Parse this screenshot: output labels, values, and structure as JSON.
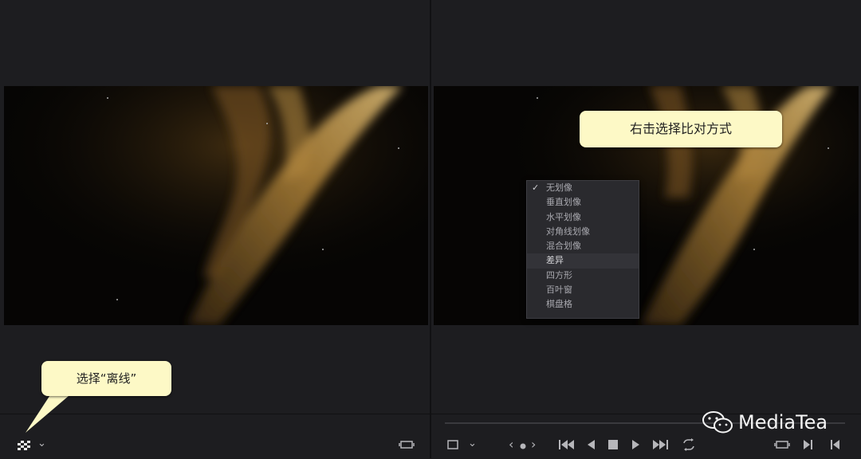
{
  "callouts": {
    "compare": "右击选择比对方式",
    "offline": "选择“离线”"
  },
  "context_menu": {
    "items": [
      {
        "label": "无划像",
        "checked": true
      },
      {
        "label": "垂直划像",
        "checked": false
      },
      {
        "label": "水平划像",
        "checked": false
      },
      {
        "label": "对角线划像",
        "checked": false
      },
      {
        "label": "混合划像",
        "checked": false
      },
      {
        "label": "差异",
        "checked": false,
        "highlighted": true
      },
      {
        "label": "四方形",
        "checked": false
      },
      {
        "label": "百叶窗",
        "checked": false
      },
      {
        "label": "棋盘格",
        "checked": false
      }
    ],
    "check_mark": "✓"
  },
  "left_controls": {
    "chevron": "⌄"
  },
  "right_controls": {
    "chevron": "⌄",
    "prev_marker": "‹",
    "next_marker": "›"
  },
  "watermark": {
    "text": "MediaTea"
  },
  "colors": {
    "callout_bg": "#fdf9c6",
    "menu_bg": "#2a2a2e",
    "panel_bg": "#1d1d20"
  }
}
